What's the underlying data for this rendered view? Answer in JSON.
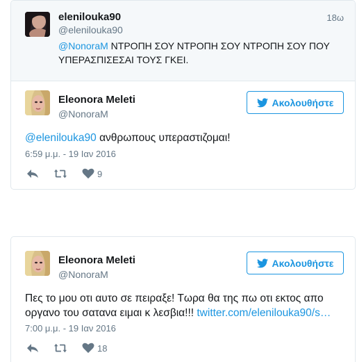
{
  "parent_tweet": {
    "display_name": "elenilouka90",
    "handle": "@elenilouka90",
    "time_ago": "18ω",
    "mention": "@NonoraM",
    "text_line1": " ΝΤΡΟΠΗ ΣΟΥ ΝΤΡΟΠΗ ΣΟΥ ΝΤΡΟΠΗ ΣΟΥ ΠΟΥ",
    "text_line2": "ΥΠΕΡΑΣΠΙΣΕΣΑΙ ΤΟΥΣ ΓΚΕΙ."
  },
  "tweet1": {
    "display_name": "Eleonora Meleti",
    "handle": "@NonoraM",
    "follow_label": "Ακολουθήστε",
    "mention": "@elenilouka90",
    "text": " ανθρωπους υπεραστιζομαι!",
    "timestamp": "6:59 μ.μ. - 19 Ιαν 2016",
    "likes": "9"
  },
  "tweet2": {
    "display_name": "Eleonora Meleti",
    "handle": "@NonoraM",
    "follow_label": "Ακολουθήστε",
    "text_line1": "Πες το μου οτι αυτο σε πειραξε! Τωρα θα της πω οτι εκτος απο",
    "text_line2": "οργανο του σατανα ειμαι κ λεσβια!!! ",
    "link": "twitter.com/elenilouka90/s…",
    "timestamp": "7:00 μ.μ. - 19 Ιαν 2016",
    "likes": "18"
  },
  "icons": {
    "reply": "reply-icon",
    "retweet": "retweet-icon",
    "like": "heart-icon",
    "follow_bird": "twitter-bird-icon"
  },
  "colors": {
    "link": "#1b95e0",
    "muted": "#657786",
    "border": "#e1e8ed",
    "parent_bg": "#f5f8fa"
  }
}
